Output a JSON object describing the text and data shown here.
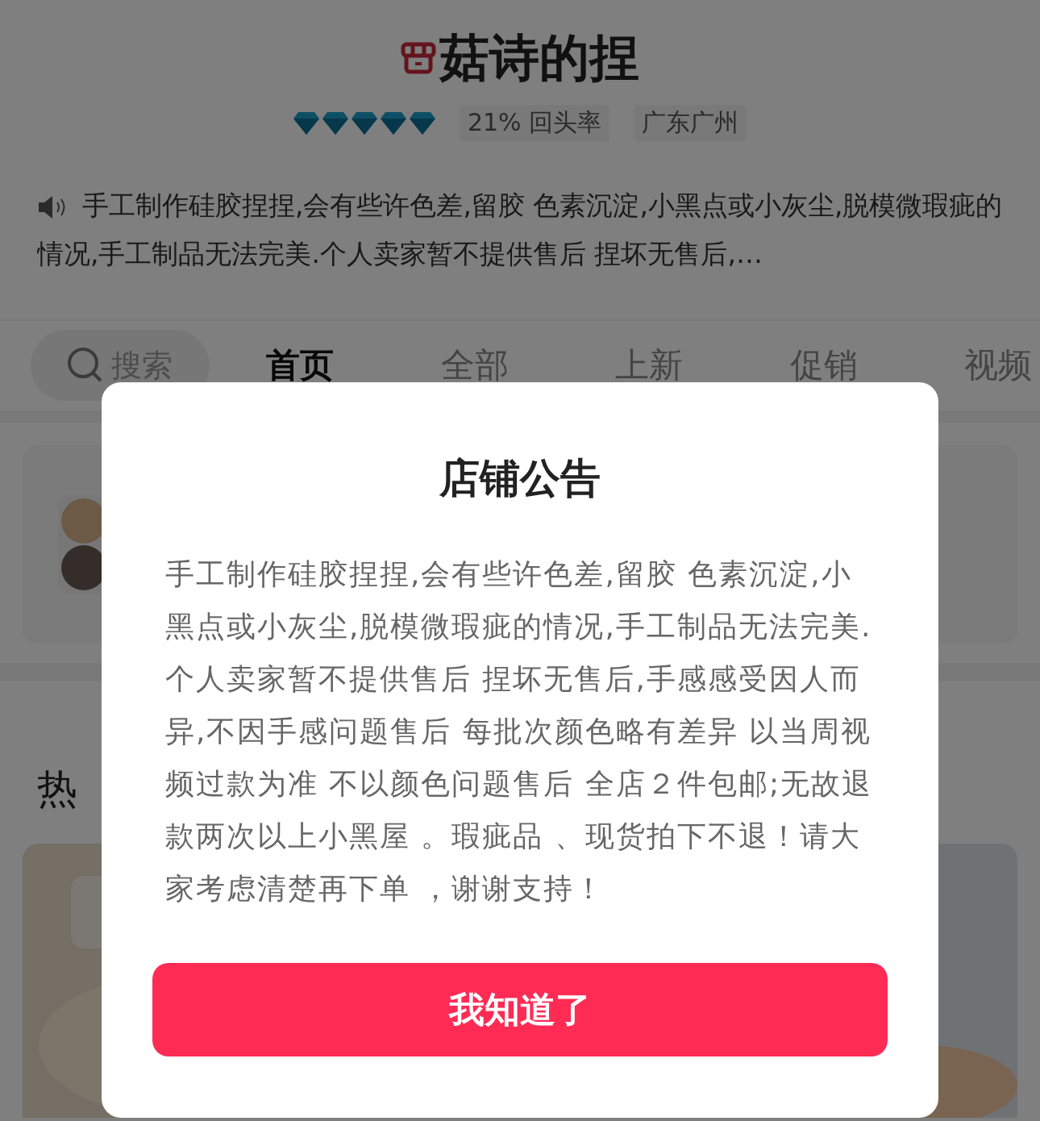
{
  "shop": {
    "name": "菇诗的捏",
    "stars": 5,
    "return_rate": "21% 回头率",
    "location": "广东广州",
    "notice": "手工制作硅胶捏捏,会有些许色差,留胶 色素沉淀,小黑点或小灰尘,脱模微瑕疵的情况,手工制品无法完美.个人卖家暂不提供售后 捏坏无售后,…"
  },
  "nav": {
    "search": {
      "placeholder": "搜索"
    },
    "tabs": [
      {
        "label": "首页",
        "selected": true
      },
      {
        "label": "全部",
        "selected": false
      },
      {
        "label": "上新",
        "selected": false
      },
      {
        "label": "促销",
        "selected": false
      },
      {
        "label": "视频",
        "selected": false
      }
    ]
  },
  "section": {
    "title": "热"
  },
  "dialog": {
    "title": "店铺公告",
    "body": "手工制作硅胶捏捏,会有些许色差,留胶 色素沉淀,小黑点或小灰尘,脱模微瑕疵的情况,手工制品无法完美.个人卖家暂不提供售后 捏坏无售后,手感感受因人而异,不因手感问题售后 每批次颜色略有差异 以当周视频过款为准 不以颜色问题售后 全店２件包邮;无故退款两次以上小黑屋 。瑕疵品 、现货拍下不退！请大家考虑清楚再下单 ，谢谢支持！",
    "button": "我知道了"
  }
}
